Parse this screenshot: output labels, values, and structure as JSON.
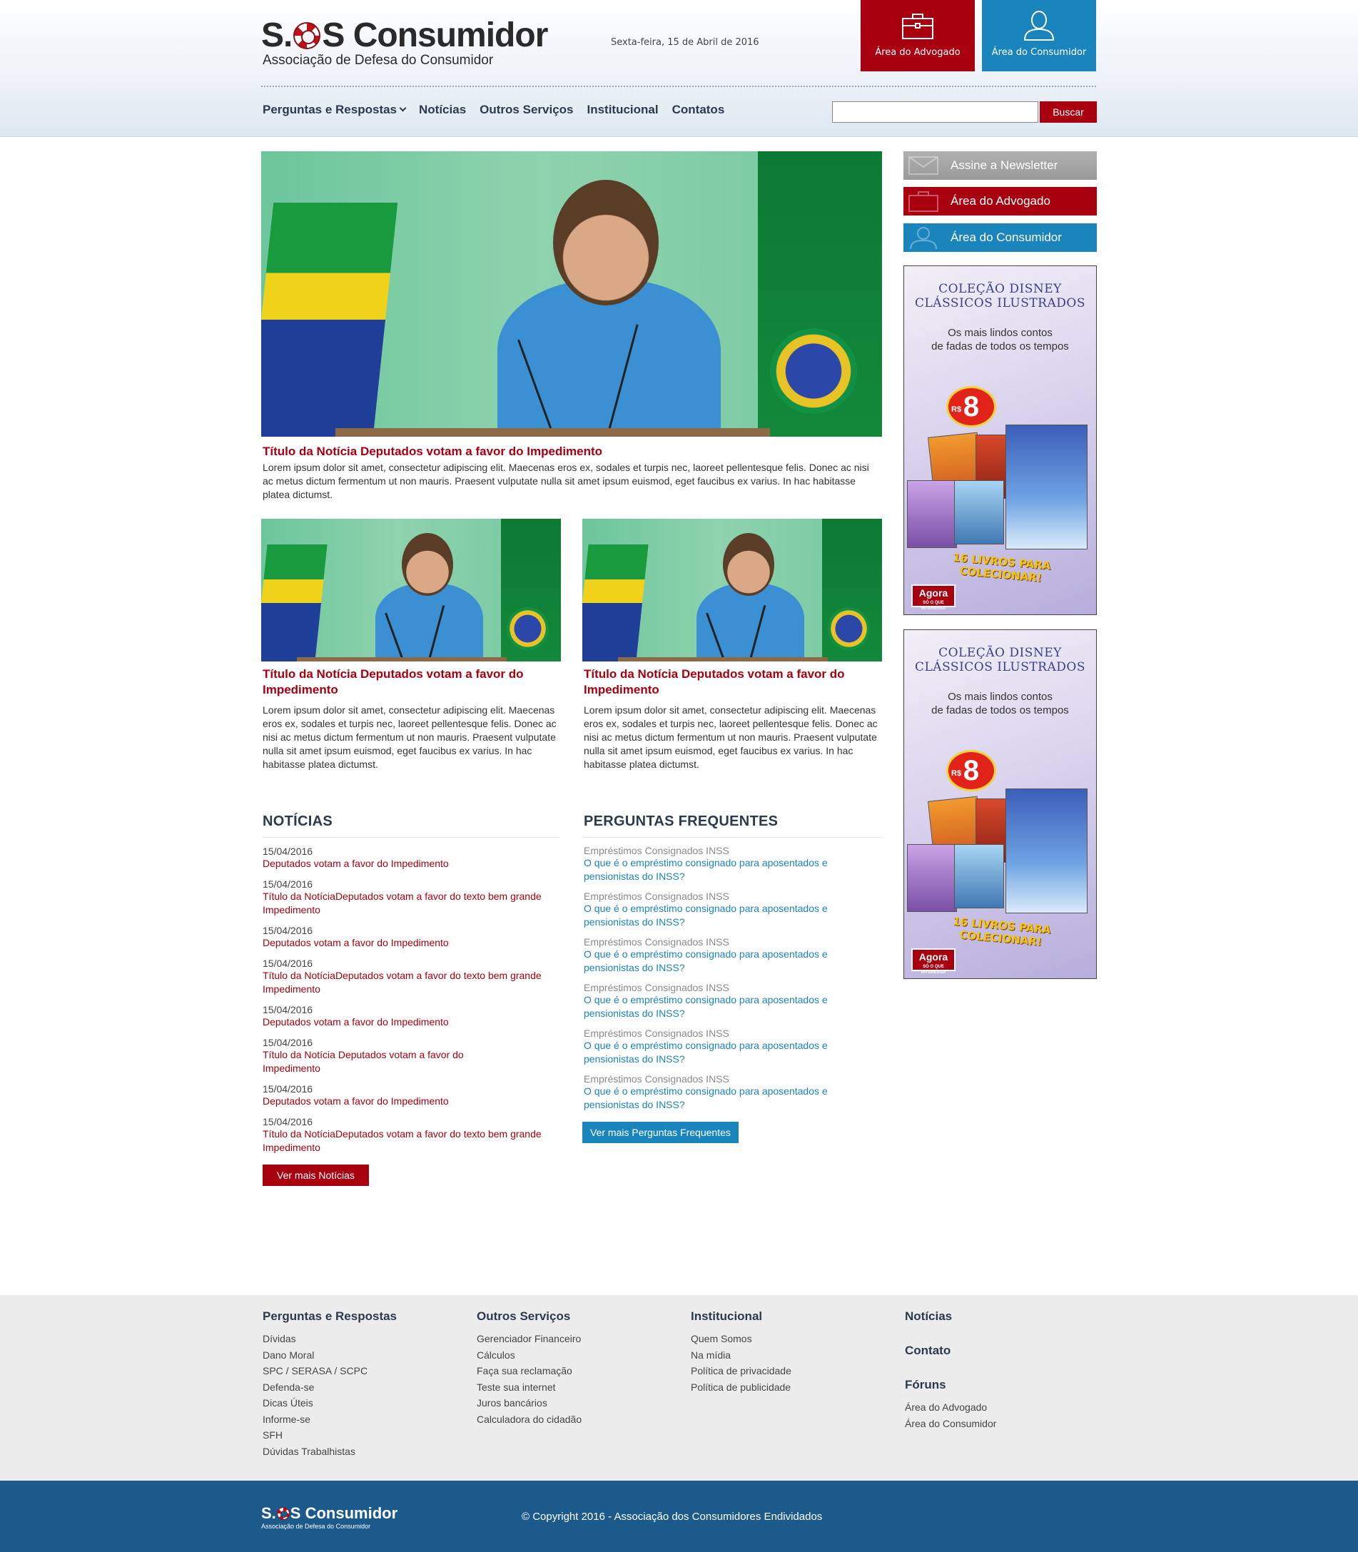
{
  "header": {
    "logo_title_pre": "S.",
    "logo_title_post": "S Consumidor",
    "logo_subtitle": "Associação de Defesa do Consumidor",
    "date": "Sexta-feira, 15 de Abril de 2016",
    "advogado_label": "Área do Advogado",
    "consumidor_label": "Área do Consumidor"
  },
  "nav": {
    "items": [
      "Perguntas e Respostas",
      "Notícias",
      "Outros Serviços",
      "Institucional",
      "Contatos"
    ],
    "search_placeholder": "",
    "search_button": "Buscar"
  },
  "featured": {
    "title": "Título da Notícia Deputados votam a favor do Impedimento",
    "text": "Lorem ipsum dolor sit amet, consectetur adipiscing elit. Maecenas eros ex, sodales et turpis nec, laoreet pellentesque felis. Donec ac nisi ac metus dictum fermentum ut non mauris. Praesent vulputate nulla sit amet ipsum euismod, eget faucibus ex varius. In hac habitasse platea dictumst."
  },
  "secondary": [
    {
      "title": "Título da Notícia Deputados votam a favor do Impedimento",
      "text": "Lorem ipsum dolor sit amet, consectetur adipiscing elit. Maecenas eros ex, sodales et turpis nec, laoreet pellentesque felis. Donec ac nisi ac metus dictum fermentum ut non mauris. Praesent vulputate nulla sit amet ipsum euismod, eget faucibus ex varius. In hac habitasse platea dictumst."
    },
    {
      "title": "Título da Notícia Deputados votam a favor do Impedimento",
      "text": "Lorem ipsum dolor sit amet, consectetur adipiscing elit. Maecenas eros ex, sodales et turpis nec, laoreet pellentesque felis. Donec ac nisi ac metus dictum fermentum ut non mauris. Praesent vulputate nulla sit amet ipsum euismod, eget faucibus ex varius. In hac habitasse platea dictumst."
    }
  ],
  "noticias": {
    "heading": "NOTÍCIAS",
    "items": [
      {
        "date": "15/04/2016",
        "title": "Deputados votam a favor do Impedimento"
      },
      {
        "date": "15/04/2016",
        "title": "Título da NotíciaDeputados votam a favor do texto bem grande Impedimento"
      },
      {
        "date": "15/04/2016",
        "title": "Deputados votam a favor do Impedimento"
      },
      {
        "date": "15/04/2016",
        "title": "Título da NotíciaDeputados votam a favor do texto bem grande Impedimento"
      },
      {
        "date": "15/04/2016",
        "title": "Deputados votam a favor do Impedimento"
      },
      {
        "date": "15/04/2016",
        "title": "Título da Notícia Deputados votam a favor do Impedimento"
      },
      {
        "date": "15/04/2016",
        "title": "Deputados votam a favor do Impedimento"
      },
      {
        "date": "15/04/2016",
        "title": "Título da NotíciaDeputados votam a favor do texto bem grande Impedimento"
      }
    ],
    "more_label": "Ver mais Notícias"
  },
  "faq": {
    "heading": "PERGUNTAS FREQUENTES",
    "items": [
      {
        "category": "Empréstimos Consignados INSS",
        "question": "O que é o empréstimo consignado para aposentados e pensionistas do INSS?"
      },
      {
        "category": "Empréstimos Consignados INSS",
        "question": "O que é o empréstimo consignado para aposentados e pensionistas do INSS?"
      },
      {
        "category": "Empréstimos Consignados INSS",
        "question": "O que é o empréstimo consignado para aposentados e pensionistas do INSS?"
      },
      {
        "category": "Empréstimos Consignados INSS",
        "question": "O que é o empréstimo consignado para aposentados e pensionistas do INSS?"
      },
      {
        "category": "Empréstimos Consignados INSS",
        "question": "O que é o empréstimo consignado para aposentados e pensionistas do INSS?"
      },
      {
        "category": "Empréstimos Consignados INSS",
        "question": "O que é o empréstimo consignado para aposentados e pensionistas do INSS?"
      }
    ],
    "more_label": "Ver mais Perguntas Frequentes"
  },
  "sidebar": {
    "newsletter": "Assine a Newsletter",
    "advogado": "Área do Advogado",
    "consumidor": "Área do Consumidor",
    "ad": {
      "title_line1": "COLEÇÃO DISNEY",
      "title_line2": "CLÁSSICOS ILUSTRADOS",
      "sub_line1": "Os mais lindos contos",
      "sub_line2": "de fadas de todos os tempos",
      "price_currency": "R$",
      "price": "8",
      "slogan": "16 LIVROS PARA COLECIONAR!",
      "brand": "Agora",
      "brand_tagline": "SÓ O QUE INTERESSA"
    }
  },
  "footer": {
    "columns": [
      {
        "heading": "Perguntas e Respostas",
        "links": [
          "Dívidas",
          "Dano Moral",
          "SPC / SERASA / SCPC",
          "Defenda-se",
          "Dicas Úteis",
          "Informe-se",
          "SFH",
          "Dúvidas Trabalhistas"
        ]
      },
      {
        "heading": "Outros Serviços",
        "links": [
          "Gerenciador Financeiro",
          "Cálculos",
          "Faça sua reclamação",
          "Teste sua internet",
          "Juros bancários",
          "Calculadora do cidadão"
        ]
      },
      {
        "heading": "Institucional",
        "links": [
          "Quem Somos",
          "Na mídia",
          "Política de privacidade",
          "Política de publicidade"
        ]
      }
    ],
    "col4": {
      "noticias": "Notícias",
      "contato": "Contato",
      "foruns": "Fóruns",
      "links": [
        "Área do Advogado",
        "Área do Consumidor"
      ]
    },
    "copyright": "© Copyright 2016 - Associação dos Consumidores Endividados"
  },
  "colors": {
    "brand_red": "#a8000f",
    "brand_blue": "#1a84bd",
    "navy": "#1c5a8c"
  }
}
